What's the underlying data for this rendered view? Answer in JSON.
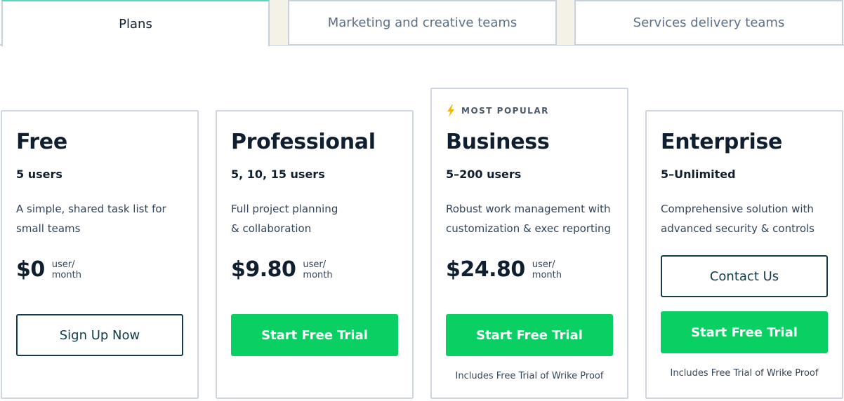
{
  "tabs": [
    {
      "label": "Plans",
      "active": true
    },
    {
      "label": "Marketing and creative teams",
      "active": false
    },
    {
      "label": "Services delivery teams",
      "active": false
    }
  ],
  "colors": {
    "accent_green": "#0acf62",
    "outline_button": "#133b4c",
    "badge_bolt": "#f5b800",
    "active_tab_top": "#5fd3c0"
  },
  "plans": [
    {
      "name": "Free",
      "users": "5 users",
      "description": "A simple, shared task list for small teams",
      "price": "$0",
      "unit_line1": "user/",
      "unit_line2": "month",
      "primary_button": "Sign Up Now"
    },
    {
      "name": "Professional",
      "users": "5, 10, 15 users",
      "description": "Full project planning & collaboration",
      "price": "$9.80",
      "unit_line1": "user/",
      "unit_line2": "month",
      "primary_button": "Start Free Trial"
    },
    {
      "badge": "MOST POPULAR",
      "badge_icon": "lightning-bolt-icon",
      "name": "Business",
      "users": "5–200 users",
      "description": "Robust work management with customization & exec reporting",
      "price": "$24.80",
      "unit_line1": "user/",
      "unit_line2": "month",
      "primary_button": "Start Free Trial",
      "note": "Includes Free Trial of Wrike Proof"
    },
    {
      "name": "Enterprise",
      "users": "5–Unlimited",
      "description": "Comprehensive solution with advanced security & controls",
      "secondary_button": "Contact Us",
      "primary_button": "Start Free Trial",
      "note": "Includes Free Trial of Wrike Proof"
    }
  ]
}
